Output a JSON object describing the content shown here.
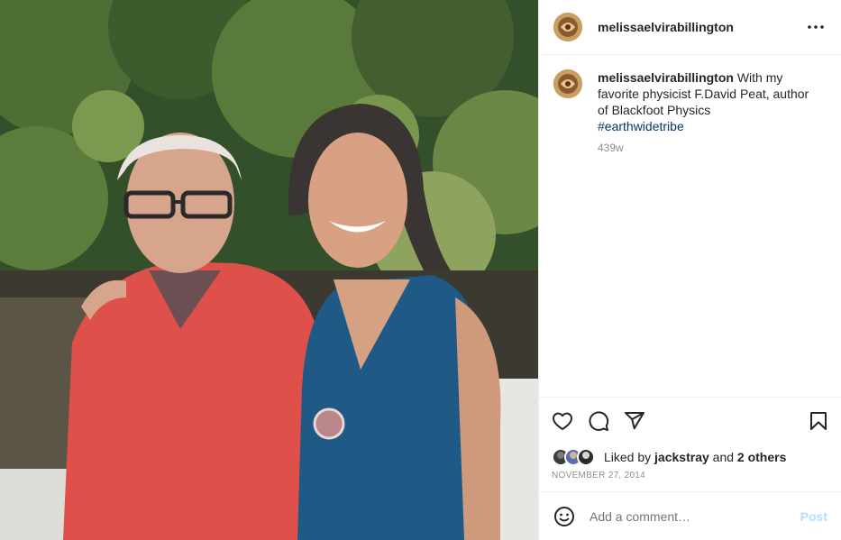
{
  "post": {
    "photo": {
      "description_icon": "photo-two-people"
    },
    "header": {
      "username": "melissaelvirabillington",
      "more_icon": "more-horizontal-icon"
    },
    "caption": {
      "username": "melissaelvirabillington",
      "text": " With my favorite physicist F.David Peat, author of Blackfoot Physics",
      "hashtag": "#earthwidetribe",
      "age": "439w"
    },
    "actions": {
      "like_icon": "heart-icon",
      "comment_icon": "comment-icon",
      "share_icon": "share-icon",
      "save_icon": "bookmark-icon"
    },
    "likes": {
      "prefix": "Liked by ",
      "first_liker": "jackstray",
      "middle": " and ",
      "others": "2 others"
    },
    "date": "NOVEMBER 27, 2014",
    "comment_box": {
      "placeholder": "Add a comment…",
      "post_label": "Post"
    },
    "colors": {
      "hashtag": "#00376b",
      "post_disabled": "#b2dffc",
      "muted": "#8e8e8e",
      "border": "#efefef"
    }
  }
}
